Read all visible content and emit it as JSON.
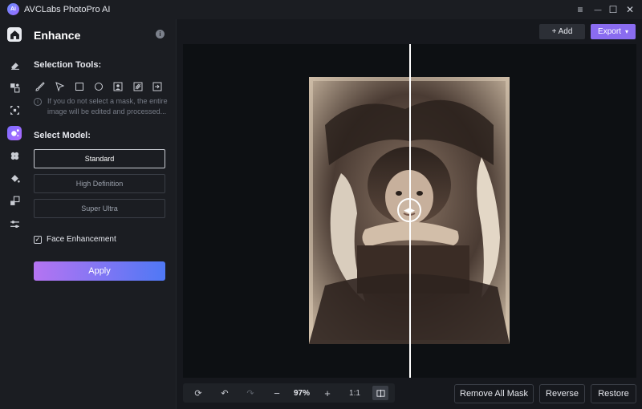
{
  "app": {
    "title": "AVCLabs PhotoPro AI",
    "logo_text": "Ai"
  },
  "window_controls": {
    "menu": "≡",
    "minimize": "—",
    "maximize": "☐",
    "close": "✕"
  },
  "rail": {
    "items": [
      "home-icon",
      "eraser-icon",
      "replace-icon",
      "expand-icon",
      "enhance-icon",
      "colorize-icon",
      "fill-icon",
      "resize-icon",
      "adjust-icon"
    ],
    "active": "enhance-icon"
  },
  "panel": {
    "title": "Enhance",
    "info": "i",
    "selection_tools_label": "Selection Tools:",
    "tools": [
      "brush-icon",
      "lasso-icon",
      "rectangle-icon",
      "ellipse-icon",
      "portrait-icon",
      "auto-select-icon",
      "import-icon"
    ],
    "hint_icon": "i",
    "hint": "If you do not select a mask, the entire image will be edited and processed...",
    "select_model_label": "Select Model:",
    "models": [
      "Standard",
      "High Definition",
      "Super Ultra"
    ],
    "selected_model": "Standard",
    "face_enhancement_label": "Face Enhancement",
    "face_enhancement_checked": true,
    "apply_label": "Apply"
  },
  "header": {
    "add_label": "+ Add",
    "export_label": "Export"
  },
  "bottombar": {
    "zoom": "97%",
    "ratio": "1:1"
  },
  "actions": {
    "remove_all_mask": "Remove All Mask",
    "reverse": "Reverse",
    "restore": "Restore"
  },
  "colors": {
    "accent": "#8a6cf0",
    "apply_gradient_start": "#b574f2",
    "apply_gradient_end": "#4f78f5"
  }
}
